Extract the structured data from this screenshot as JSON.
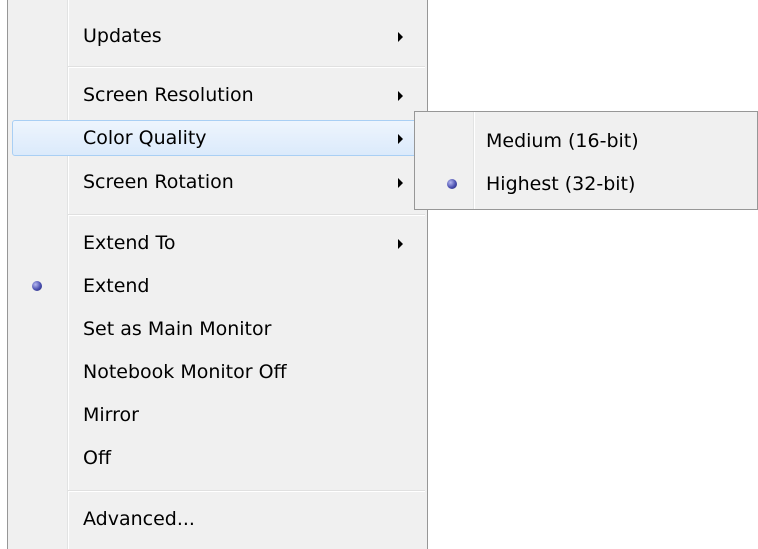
{
  "main_menu": {
    "items": [
      {
        "label": "Updates",
        "has_submenu": true
      },
      {
        "label": "Screen Resolution",
        "has_submenu": true
      },
      {
        "label": "Color Quality",
        "has_submenu": true,
        "highlighted": true
      },
      {
        "label": "Screen Rotation",
        "has_submenu": true
      },
      {
        "label": "Extend To",
        "has_submenu": true
      },
      {
        "label": "Extend",
        "checked": true
      },
      {
        "label": "Set as Main Monitor"
      },
      {
        "label": "Notebook Monitor Off"
      },
      {
        "label": "Mirror"
      },
      {
        "label": "Off"
      },
      {
        "label": "Advanced..."
      }
    ]
  },
  "color_quality_submenu": {
    "items": [
      {
        "label": "Medium (16-bit)"
      },
      {
        "label": "Highest (32-bit)",
        "checked": true
      }
    ]
  },
  "colors": {
    "highlight_border": "#a9cff4",
    "menu_background": "#f0f0f0",
    "radio": "#4a4fb0"
  },
  "icons": {
    "submenu_arrow": "arrow-right-icon",
    "checked_radio": "radio-dot-icon"
  }
}
